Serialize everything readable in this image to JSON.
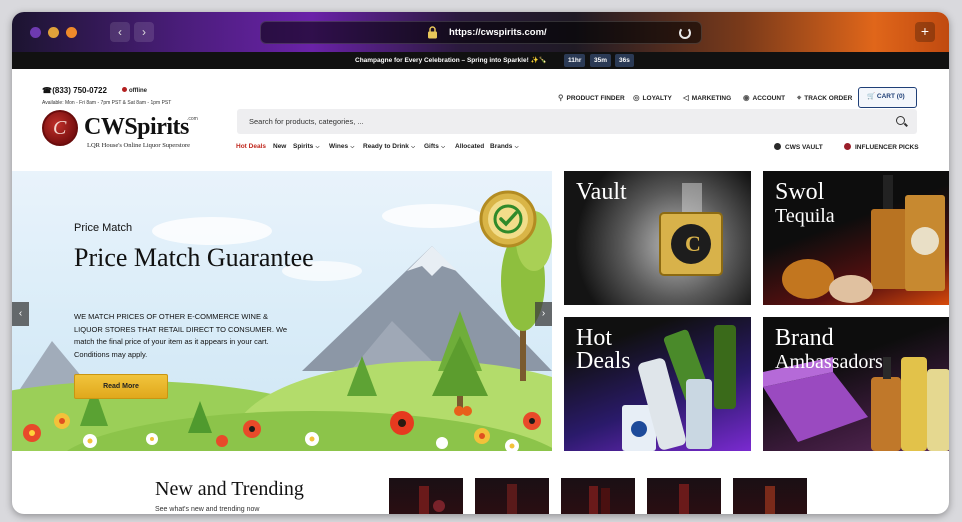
{
  "browser": {
    "url": "https://cwspirits.com/",
    "nav_back": "‹",
    "nav_forward": "›",
    "new_tab": "+"
  },
  "announcement": {
    "message": "Champagne for Every Celebration – Spring into Sparkle! ✨🍾",
    "timer": [
      "11hr",
      "35m",
      "36s"
    ]
  },
  "utility": {
    "phone": "(833) 750-0722",
    "status": "offline",
    "hours": "Available: Mon - Fri 8am - 7pm PST & Sat 8am - 1pm PST",
    "links": [
      "PRODUCT FINDER",
      "LOYALTY",
      "MARKETING",
      "ACCOUNT",
      "TRACK ORDER"
    ],
    "cart_label": "CART",
    "cart_count": "(0)"
  },
  "logo": {
    "name": "CWSpirits",
    "com": ".com",
    "tagline": "LQR House's Online Liquor Superstore",
    "seal_letter": "C"
  },
  "search": {
    "placeholder": "Search for products, categories, ..."
  },
  "nav": {
    "items": [
      "Hot Deals",
      "New",
      "Spirits",
      "Wines",
      "Ready to Drink",
      "Gifts",
      "Allocated",
      "Brands"
    ],
    "vault": "CWS VAULT",
    "influencer": "INFLUENCER PICKS"
  },
  "hero": {
    "kicker": "Price Match",
    "title": "Price Match Guarantee",
    "body": "WE MATCH PRICES OF OTHER E-COMMERCE WINE & LIQUOR STORES THAT RETAIL DIRECT TO CONSUMER. We match the final price of your item as it appears in your cart. Conditions may apply.",
    "button": "Read More",
    "prev": "‹",
    "next": "›"
  },
  "tiles": {
    "vault": "Vault",
    "swol_1": "Swol",
    "swol_2": "Tequila",
    "hot_1": "Hot",
    "hot_2": "Deals",
    "brand_1": "Brand",
    "brand_2": "Ambassadors",
    "vault_seal": "C"
  },
  "trending": {
    "title": "New and Trending",
    "subtitle": "See what's new and trending now"
  },
  "colors": {
    "accent_red": "#c0281e",
    "cart_blue": "#1f3f77",
    "button_gold": "#e8b52a"
  }
}
